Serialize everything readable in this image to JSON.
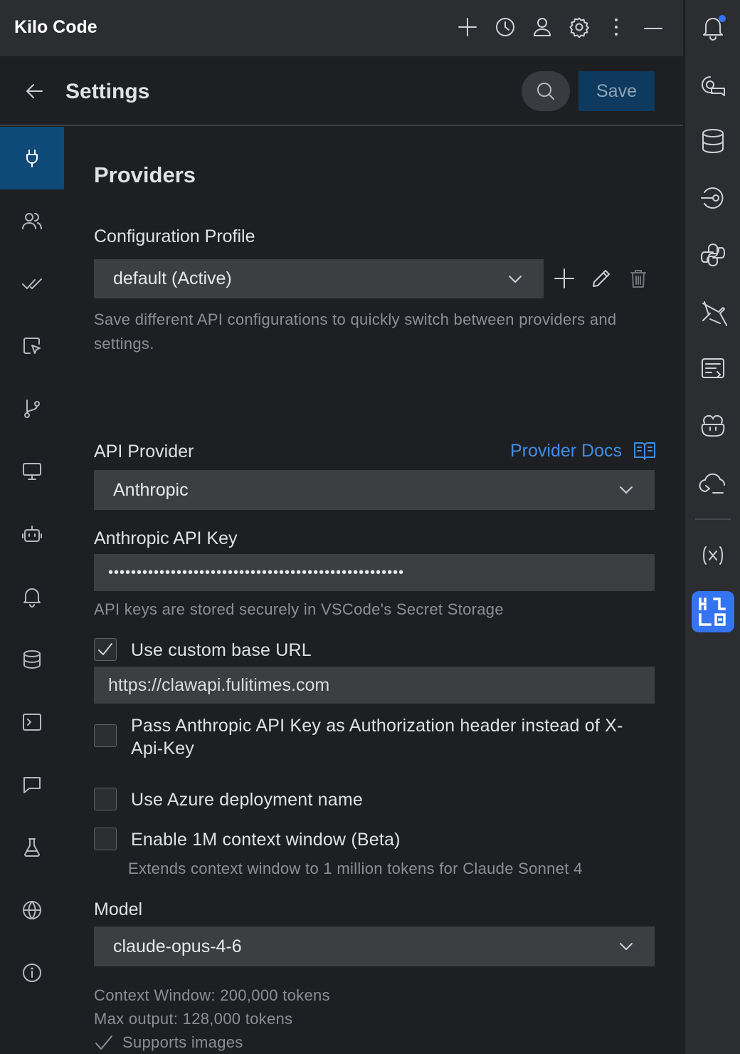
{
  "app": {
    "title": "Kilo Code"
  },
  "settings": {
    "title": "Settings",
    "save_label": "Save"
  },
  "section": {
    "title": "Providers"
  },
  "config_profile": {
    "label": "Configuration Profile",
    "selected": "default (Active)",
    "help": "Save different API configurations to quickly switch between providers and settings."
  },
  "api_provider": {
    "label": "API Provider",
    "docs_link": "Provider Docs",
    "selected": "Anthropic"
  },
  "api_key": {
    "label": "Anthropic API Key",
    "value": "••••••••••••••••••••••••••••••••••••••••••••••••••••",
    "help": "API keys are stored securely in VSCode's Secret Storage"
  },
  "options": {
    "custom_base_url": {
      "label": "Use custom base URL",
      "checked": true,
      "value": "https://clawapi.fulitimes.com"
    },
    "auth_header": {
      "label": "Pass Anthropic API Key as Authorization header instead of X-Api-Key",
      "checked": false
    },
    "azure": {
      "label": "Use Azure deployment name",
      "checked": false
    },
    "context_1m": {
      "label": "Enable 1M context window (Beta)",
      "checked": false,
      "help": "Extends context window to 1 million tokens for Claude Sonnet 4"
    }
  },
  "model": {
    "label": "Model",
    "selected": "claude-opus-4-6",
    "context_window": "Context Window: 200,000 tokens",
    "max_output": "Max output: 128,000 tokens",
    "supports_images": "Supports images"
  },
  "colors": {
    "accent": "#3574f0",
    "link": "#3d8ee6",
    "active_nav": "#0e4a78",
    "save_button": "#0d3a5e",
    "notification_dot": "#3574f0"
  },
  "icons": {
    "topbar": [
      "plus-icon",
      "history-icon",
      "user-icon",
      "gear-icon",
      "more-vertical-icon",
      "minimize-icon"
    ],
    "left_nav": [
      "plug-icon",
      "users-icon",
      "double-check-icon",
      "pointer-icon",
      "git-branch-icon",
      "monitor-icon",
      "bot-icon",
      "bell-icon",
      "database-icon",
      "terminal-icon",
      "chat-icon",
      "flask-icon",
      "globe-icon",
      "info-icon"
    ],
    "right_bar": [
      "notification-bell-icon",
      "ai-chat-icon",
      "database-icon",
      "endpoints-icon",
      "python-icon",
      "plane-icon",
      "code-review-icon",
      "copilot-icon",
      "cloud-terminal-icon",
      "variables-icon",
      "kilo-logo-icon"
    ]
  }
}
